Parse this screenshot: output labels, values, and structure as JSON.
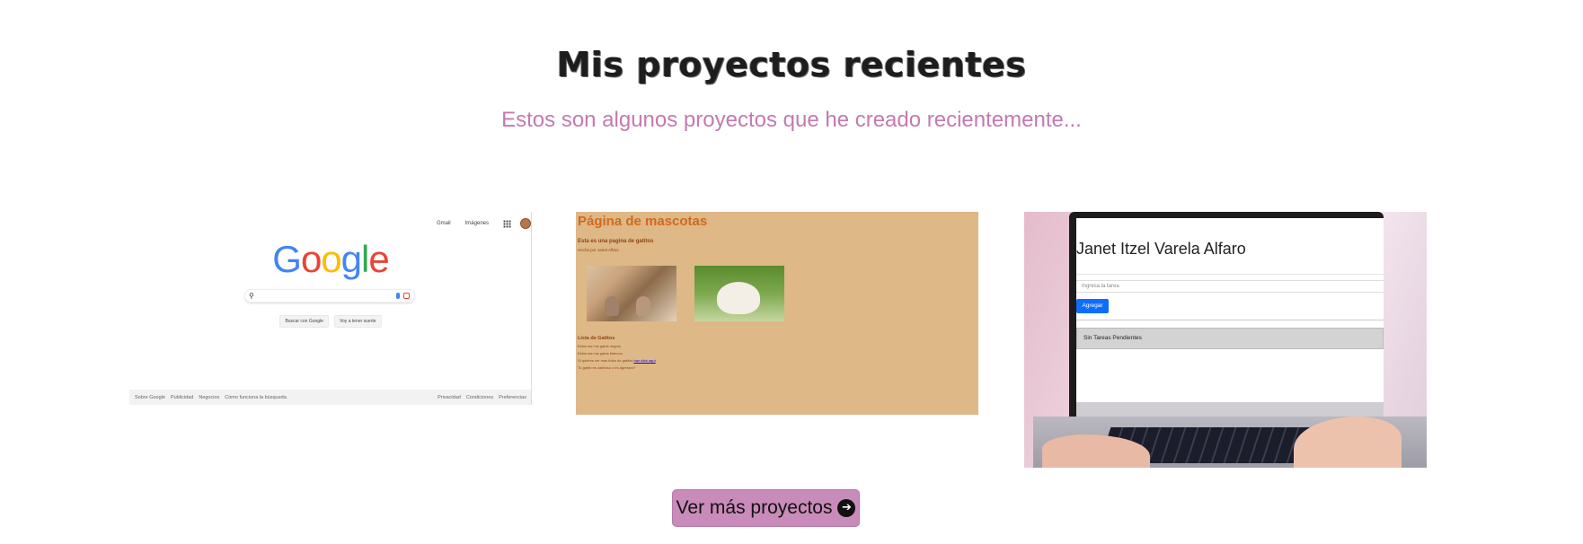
{
  "section": {
    "title": "Mis proyectos recientes",
    "subtitle": "Estos son algunos proyectos que he creado recientemente..."
  },
  "projects": {
    "google": {
      "top_links": [
        "Gmail",
        "Imágenes"
      ],
      "logo": "Google",
      "buttons": [
        "Buscar con Google",
        "Voy a tener suerte"
      ],
      "footer_left": [
        "Sobre Google",
        "Publicidad",
        "Negocios",
        "Cómo funciona la búsqueda"
      ],
      "footer_right": [
        "Privacidad",
        "Condiciones",
        "Preferencias"
      ]
    },
    "pets": {
      "title": "Página de mascotas",
      "subtitle": "Esta es una pagina de gatitos",
      "byline": "Hecha por Janet Alfaro",
      "list_title": "Lista de Gatitos",
      "note1": "Estos son los gatos negros",
      "note2": "Estos son los gatos blancos",
      "note3": "Si quieres ver mas fotos de gatitos",
      "note3_link": "haz click aquí",
      "note4": "Tu gatito es cariñoso o es agresivo?"
    },
    "todo": {
      "name": "Janet Itzel Varela Alfaro",
      "input_placeholder": "Ingresa la tarea",
      "add_label": "Agregar",
      "pending": "Sin Tareas Pendientes"
    }
  },
  "cta": {
    "label": "Ver más proyectos",
    "icon": "arrow-right-circle-icon"
  },
  "colors": {
    "subtitle": "#c47ab1",
    "button_bg": "#c98bb9",
    "pets_bg": "#deb887"
  }
}
